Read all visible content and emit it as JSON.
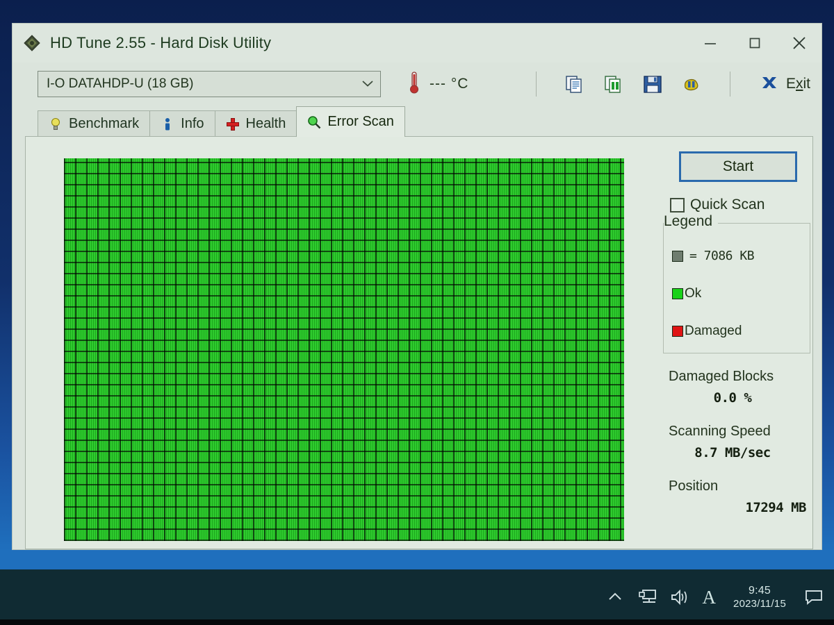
{
  "window": {
    "title": "HD Tune 2.55 - Hard Disk Utility",
    "app_icon": "hdtune-diamond-icon",
    "controls": {
      "minimize": "minimize-icon",
      "maximize": "maximize-icon",
      "close": "close-icon"
    }
  },
  "toolbar": {
    "drive_selected": "I-O DATAHDP-U (18 GB)",
    "drive_chevron": "chevron-down-icon",
    "temperature": "--- °C",
    "thermometer_icon": "thermometer-icon",
    "buttons": [
      {
        "icon": "copy-icon",
        "name": "copy-button"
      },
      {
        "icon": "copy-report-icon",
        "name": "copy-report-button"
      },
      {
        "icon": "save-floppy-icon",
        "name": "save-button"
      },
      {
        "icon": "options-icon",
        "name": "options-button"
      }
    ],
    "exit_icon": "exit-x-icon",
    "exit_label_pre": "E",
    "exit_label_accel": "x",
    "exit_label_post": "it"
  },
  "tabs": [
    {
      "label": "Benchmark",
      "icon": "lightbulb-icon",
      "active": false
    },
    {
      "label": "Info",
      "icon": "info-person-icon",
      "active": false
    },
    {
      "label": "Health",
      "icon": "red-cross-icon",
      "active": false
    },
    {
      "label": "Error Scan",
      "icon": "magnifier-icon",
      "active": true
    }
  ],
  "error_scan": {
    "start_button": "Start",
    "quick_scan_label": "Quick Scan",
    "quick_scan_checked": false,
    "legend": {
      "title": "Legend",
      "block_size": "= 7086 KB",
      "ok_label": "Ok",
      "damaged_label": "Damaged"
    },
    "stats": [
      {
        "label": "Damaged Blocks",
        "value": "0.0 %"
      },
      {
        "label": "Scanning Speed",
        "value": "8.7 MB/sec"
      },
      {
        "label": "Position",
        "value": "17294 MB"
      }
    ],
    "map": {
      "status": "ok",
      "columns": 50,
      "rows": 34
    }
  },
  "colors": {
    "ok_block": "#23c823",
    "damaged_block": "#df1414",
    "block_size_swatch": "#6f7d6f",
    "focus_border": "#2a6aad",
    "window_bg": "#dbe4dc",
    "desktop": "#11306b",
    "taskbar": "#102b33"
  },
  "taskbar": {
    "icons": [
      {
        "name": "show-hidden-icons-chevron-icon"
      },
      {
        "name": "network-icon"
      },
      {
        "name": "volume-icon"
      },
      {
        "name": "ime-mode-indicator"
      }
    ],
    "ime_letter": "A",
    "time": "9:45",
    "date": "2023/11/15",
    "action_center_icon": "action-center-icon"
  }
}
